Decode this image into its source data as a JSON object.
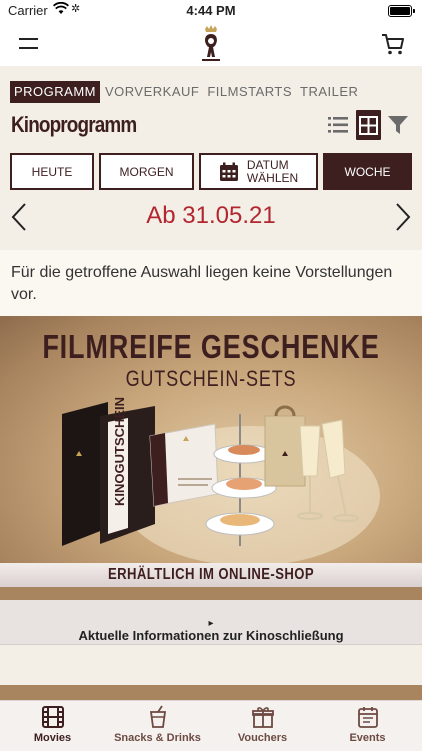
{
  "status_bar": {
    "carrier": "Carrier",
    "time": "4:44 PM"
  },
  "header": {
    "logo_text": "GLORIA PALAST",
    "logo_letter": "g"
  },
  "tabs": [
    {
      "label": "PROGRAMM",
      "active": true
    },
    {
      "label": "VORVERKAUF",
      "active": false
    },
    {
      "label": "FILMSTARTS",
      "active": false
    },
    {
      "label": "TRAILER",
      "active": false
    }
  ],
  "page_title": "Kinoprogramm",
  "day_buttons": {
    "heute": "HEUTE",
    "morgen": "MORGEN",
    "datum_line1": "DATUM",
    "datum_line2": "WÄHLEN",
    "woche": "WOCHE"
  },
  "date_nav": {
    "label": "Ab 31.05.21"
  },
  "notice": "Für die getroffene Auswahl liegen keine Vorstellungen vor.",
  "banner": {
    "title": "FILMREIFE GESCHENKE",
    "subtitle": "GUTSCHEIN-SETS",
    "product_text": "KINOGUTSCHEIN",
    "cta": "ERHÄLTLICH IM ONLINE-SHOP"
  },
  "info_bar": {
    "label": "Aktuelle Informationen zur Kinoschließung",
    "arrow": "▸"
  },
  "tab_bar": [
    {
      "label": "Movies",
      "icon": "film-icon",
      "active": true
    },
    {
      "label": "Snacks & Drinks",
      "icon": "drink-icon",
      "active": false
    },
    {
      "label": "Vouchers",
      "icon": "gift-icon",
      "active": false
    },
    {
      "label": "Events",
      "icon": "calendar-icon",
      "active": false
    }
  ],
  "colors": {
    "brand_dark": "#3e1f1f",
    "accent_red": "#b3262f",
    "background": "#f3eee6"
  }
}
